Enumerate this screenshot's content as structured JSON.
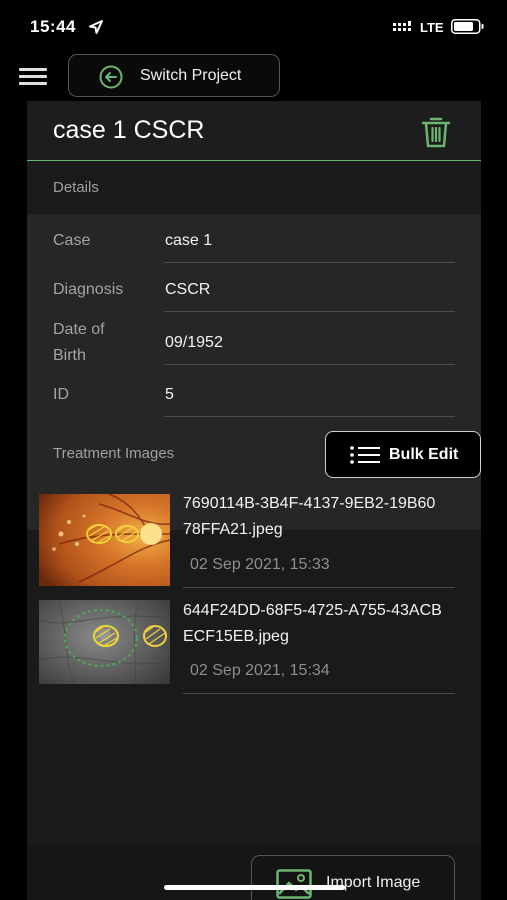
{
  "status_bar": {
    "time": "15:44",
    "network": "LTE"
  },
  "toolbar": {
    "switch_label": "Switch Project"
  },
  "case": {
    "title": "case 1 CSCR"
  },
  "details": {
    "section_label": "Details",
    "rows": [
      {
        "key": "Case",
        "value": "case 1"
      },
      {
        "key": "Diagnosis",
        "value": "CSCR"
      },
      {
        "key": "Date of Birth",
        "value": "09/1952"
      },
      {
        "key": "ID",
        "value": "5"
      }
    ]
  },
  "treatment": {
    "section_label": "Treatment Images",
    "bulk_edit_label": "Bulk Edit",
    "images": [
      {
        "file_name": "7690114B-3B4F-4137-9EB2-19B6078FFA21.jpeg",
        "date": "02 Sep 2021, 15:33",
        "thumbnail": "fundus-photo"
      },
      {
        "file_name": "644F24DD-68F5-4725-A755-43ACBECF15EB.jpeg",
        "date": "02 Sep 2021, 15:34",
        "thumbnail": "angiogram-photo"
      }
    ]
  },
  "footer": {
    "import_label": "Import Image"
  },
  "colors": {
    "accent": "#6cb56e",
    "background": "#000000",
    "panel": "#1a1a1a",
    "card": "#262626"
  }
}
